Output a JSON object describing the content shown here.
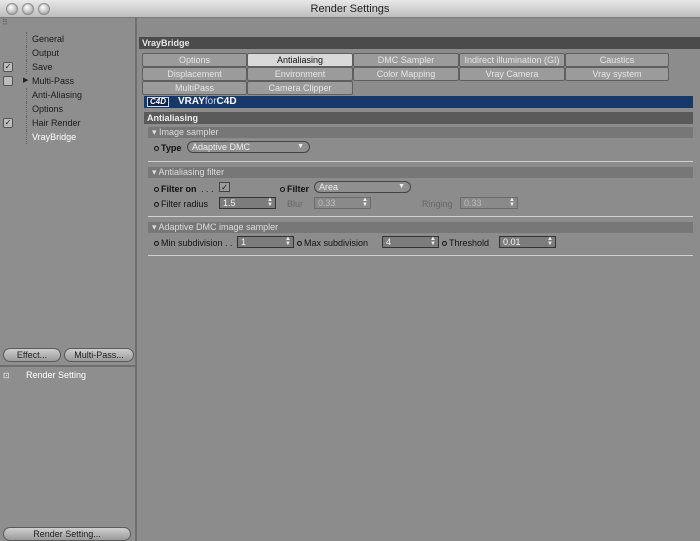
{
  "window": {
    "title": "Render Settings"
  },
  "sidebar": {
    "items": [
      {
        "label": "General",
        "checkbox": false,
        "expander": false,
        "active": false
      },
      {
        "label": "Output",
        "checkbox": false,
        "expander": false,
        "active": false
      },
      {
        "label": "Save",
        "checkbox": true,
        "checked": true,
        "expander": false,
        "active": false
      },
      {
        "label": "Multi-Pass",
        "checkbox": true,
        "checked": false,
        "expander": true,
        "active": false
      },
      {
        "label": "Anti-Aliasing",
        "checkbox": false,
        "expander": false,
        "active": false
      },
      {
        "label": "Options",
        "checkbox": false,
        "expander": false,
        "active": false
      },
      {
        "label": "Hair Render",
        "checkbox": true,
        "checked": true,
        "expander": false,
        "active": false
      },
      {
        "label": "VrayBridge",
        "checkbox": false,
        "expander": false,
        "active": true
      }
    ],
    "effect_button": "Effect...",
    "multipass_button": "Multi-Pass...",
    "render_setting_item": "Render Setting",
    "render_setting_button": "Render Setting..."
  },
  "main": {
    "header": "VrayBridge",
    "tabs_row1": [
      "Options",
      "Antialiasing",
      "DMC Sampler",
      "Indirect illumination (GI)",
      "Caustics"
    ],
    "tabs_row2": [
      "Displacement",
      "Environment",
      "Color Mapping",
      "Vray Camera",
      "Vray system"
    ],
    "tabs_row3": [
      "MultiPass",
      "Camera Clipper"
    ],
    "active_tab": "Antialiasing",
    "banner": {
      "mark": "C4D",
      "brand": "VRAY",
      "for": "for",
      "product": "C4D"
    },
    "section_title": "Antialiasing",
    "image_sampler": {
      "group": "Image sampler",
      "type_label": "Type",
      "type_value": "Adaptive DMC"
    },
    "aa_filter": {
      "group": "Antialiasing filter",
      "filter_on_label": "Filter on",
      "filter_on_dots": ". . .",
      "filter_on_checked": true,
      "filter_label": "Filter",
      "filter_value": "Area",
      "filter_radius_label": "Filter radius",
      "filter_radius_value": "1.5",
      "blur_label": "Blur",
      "blur_value": "0.33",
      "ringing_label": "Ringing",
      "ringing_value": "0.33"
    },
    "adaptive_dmc": {
      "group": "Adaptive DMC image sampler",
      "min_label": "Min subdivision",
      "min_dots": ". .",
      "min_value": "1",
      "max_label": "Max subdivision",
      "max_value": "4",
      "threshold_label": "Threshold",
      "threshold_value": "0.01"
    }
  }
}
